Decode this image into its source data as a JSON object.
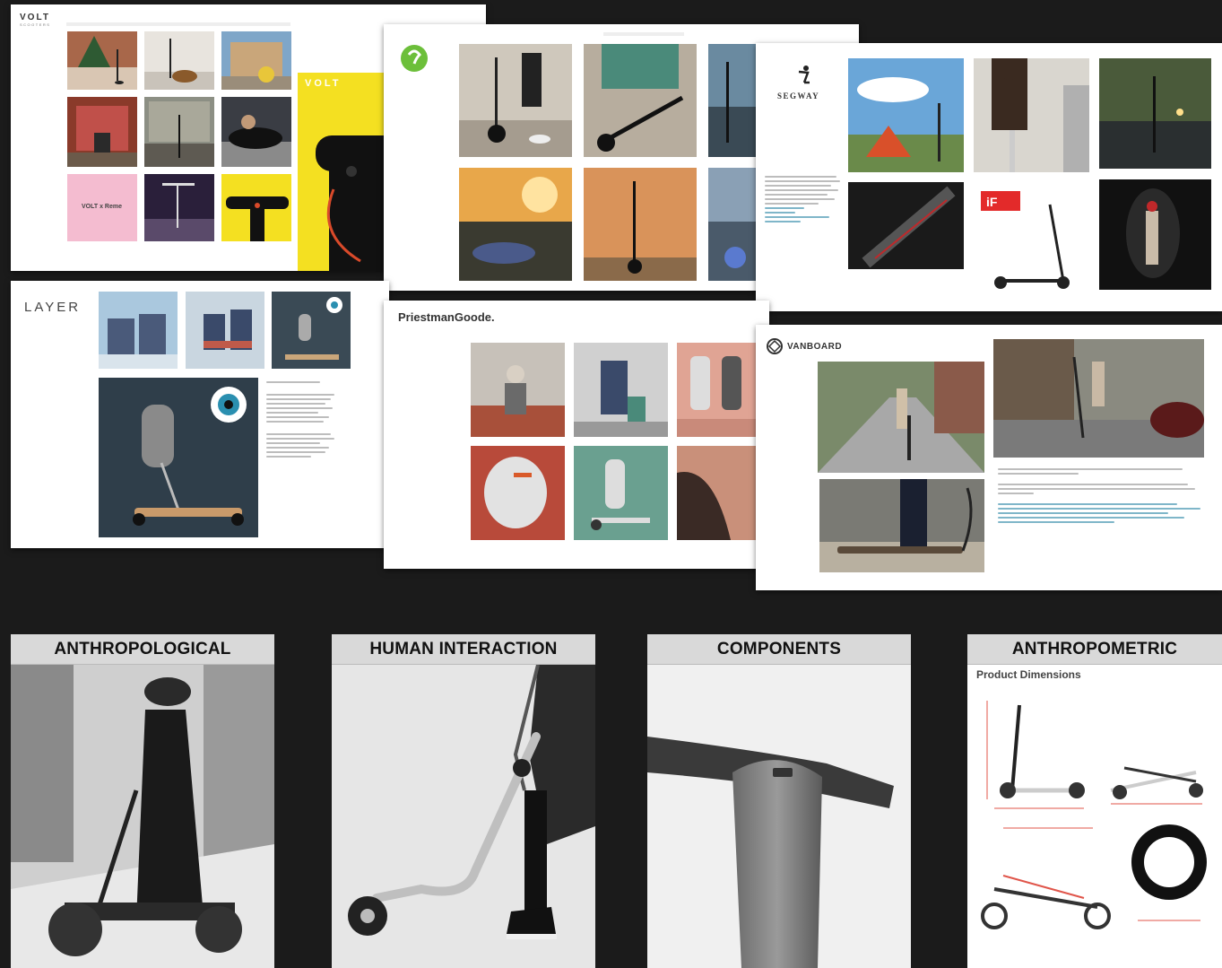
{
  "brands": {
    "volt": "VOLT",
    "volt_sub": "SCOOTERS",
    "volt_tile": "VOLT",
    "volt_pink": "VOLT x Reme",
    "layer": "LAYER",
    "segway": "SEGWAY",
    "priestman": "PriestmanGoode.",
    "vanboard": "VANBOARD"
  },
  "categories": [
    {
      "label": "ANTHROPOLOGICAL"
    },
    {
      "label": "HUMAN INTERACTION"
    },
    {
      "label": "COMPONENTS"
    },
    {
      "label": "ANTHROPOMETRIC"
    }
  ],
  "anthropometric": {
    "subtitle": "Product Dimensions"
  },
  "colors": {
    "background": "#1b1b1b",
    "volt_yellow": "#f4e021",
    "header_gray": "#d9d9d9",
    "link_blue": "#2a8fb0"
  }
}
